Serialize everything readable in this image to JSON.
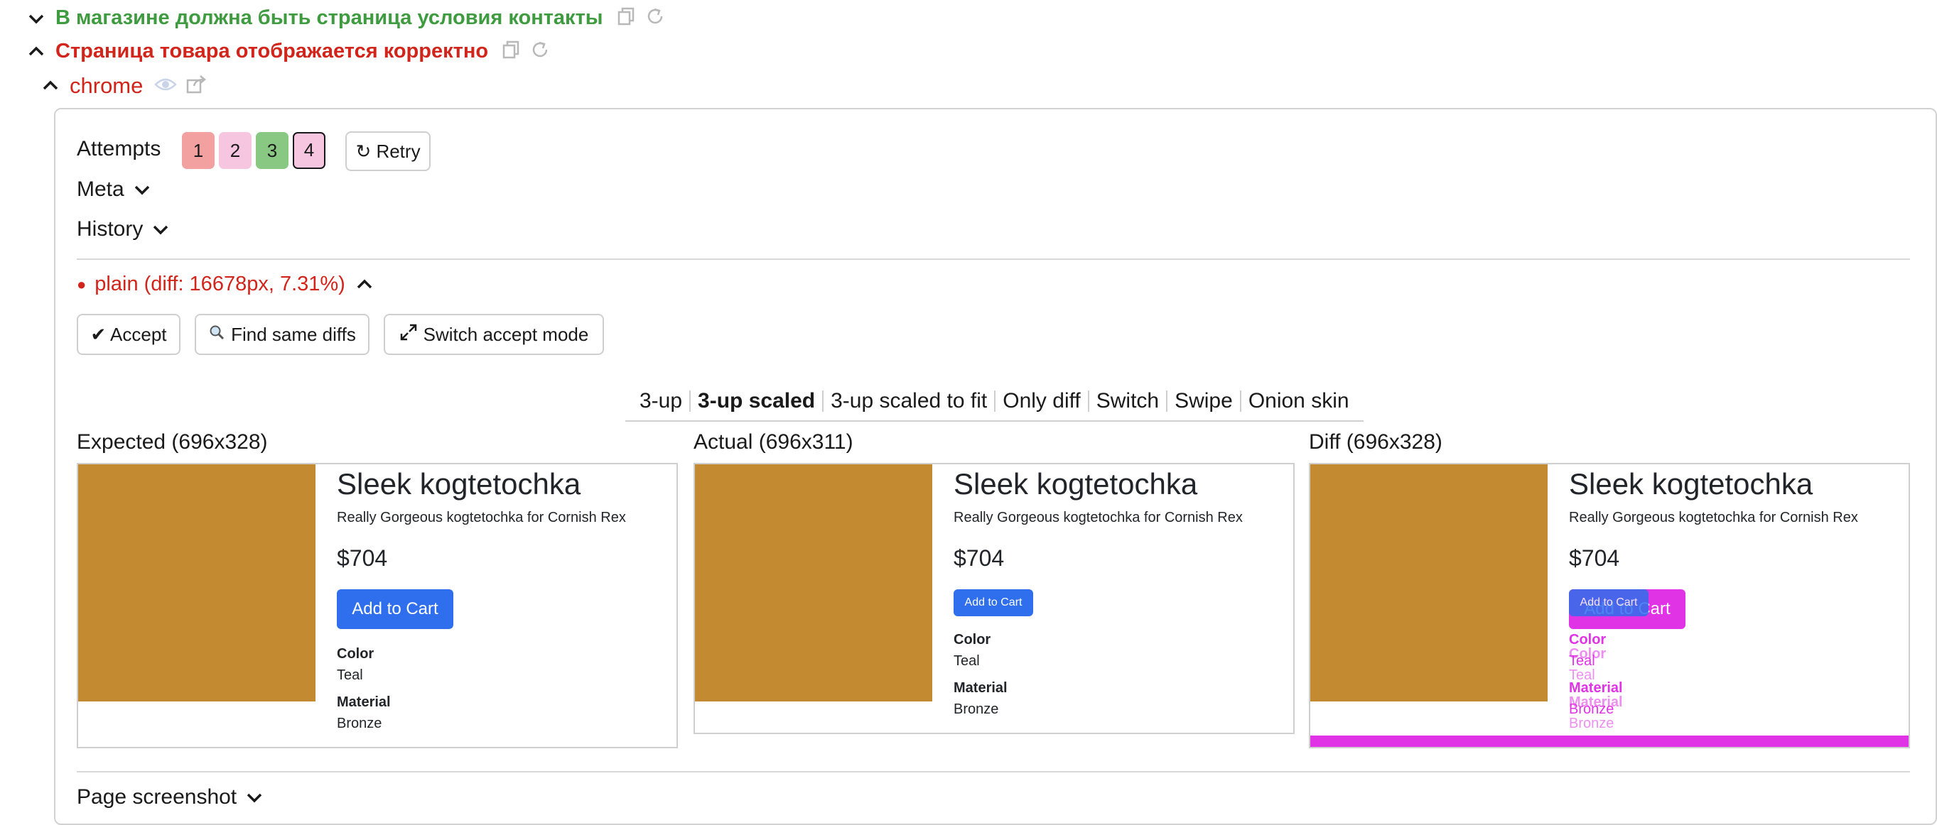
{
  "suites": [
    {
      "title": "В магазине должна быть страница условия контакты",
      "status": "passed",
      "expanded": false
    },
    {
      "title": "Страница товара отображается корректно",
      "status": "failed",
      "expanded": true
    }
  ],
  "browser": {
    "name": "chrome"
  },
  "attempts": {
    "label": "Attempts",
    "items": [
      {
        "label": "1",
        "status": "failed",
        "color": "#f2a0a0"
      },
      {
        "label": "2",
        "status": "failed",
        "color": "#f6c6e0"
      },
      {
        "label": "3",
        "status": "passed",
        "color": "#88c882"
      },
      {
        "label": "4",
        "status": "failed",
        "color": "#f6c6e0"
      }
    ],
    "retry_label": "↻ Retry"
  },
  "sections": {
    "meta": "Meta",
    "history": "History",
    "page_screenshot": "Page screenshot"
  },
  "diff_header": {
    "bullet": "●",
    "text": "plain (diff: 16678px, 7.31%)"
  },
  "actions": {
    "accept": "✔ Accept",
    "find_same": "Find same diffs",
    "switch_mode": "Switch accept mode"
  },
  "view_modes": {
    "items": [
      "3-up",
      "3-up scaled",
      "3-up scaled to fit",
      "Only diff",
      "Switch",
      "Swipe",
      "Onion skin"
    ],
    "active": "3-up scaled"
  },
  "images": {
    "expected": {
      "title": "Expected (696x328)",
      "product": {
        "name": "Sleek kogtetochka",
        "description": "Really Gorgeous kogtetochka for Cornish Rex",
        "price": "$704",
        "button": "Add to Cart",
        "color_label": "Color",
        "color_value": "Teal",
        "material_label": "Material",
        "material_value": "Bronze"
      }
    },
    "actual": {
      "title": "Actual (696x311)",
      "product": {
        "name": "Sleek kogtetochka",
        "description": "Really Gorgeous kogtetochka for Cornish Rex",
        "price": "$704",
        "button": "Add to Cart",
        "color_label": "Color",
        "color_value": "Teal",
        "material_label": "Material",
        "material_value": "Bronze"
      }
    },
    "diff": {
      "title": "Diff (696x328)",
      "product": {
        "name": "Sleek kogtetochka",
        "description": "Really Gorgeous kogtetochka for Cornish Rex",
        "price": "$704",
        "button": "Add to Cart",
        "color_label": "Color",
        "color_value": "Teal",
        "material_label": "Material",
        "material_value": "Bronze"
      },
      "diff_color": "#e033e6"
    }
  },
  "colors": {
    "passed": "#3f9b3f",
    "failed": "#d1241b",
    "product_image": "#c48a32",
    "button_blue": "#2f6fed"
  }
}
